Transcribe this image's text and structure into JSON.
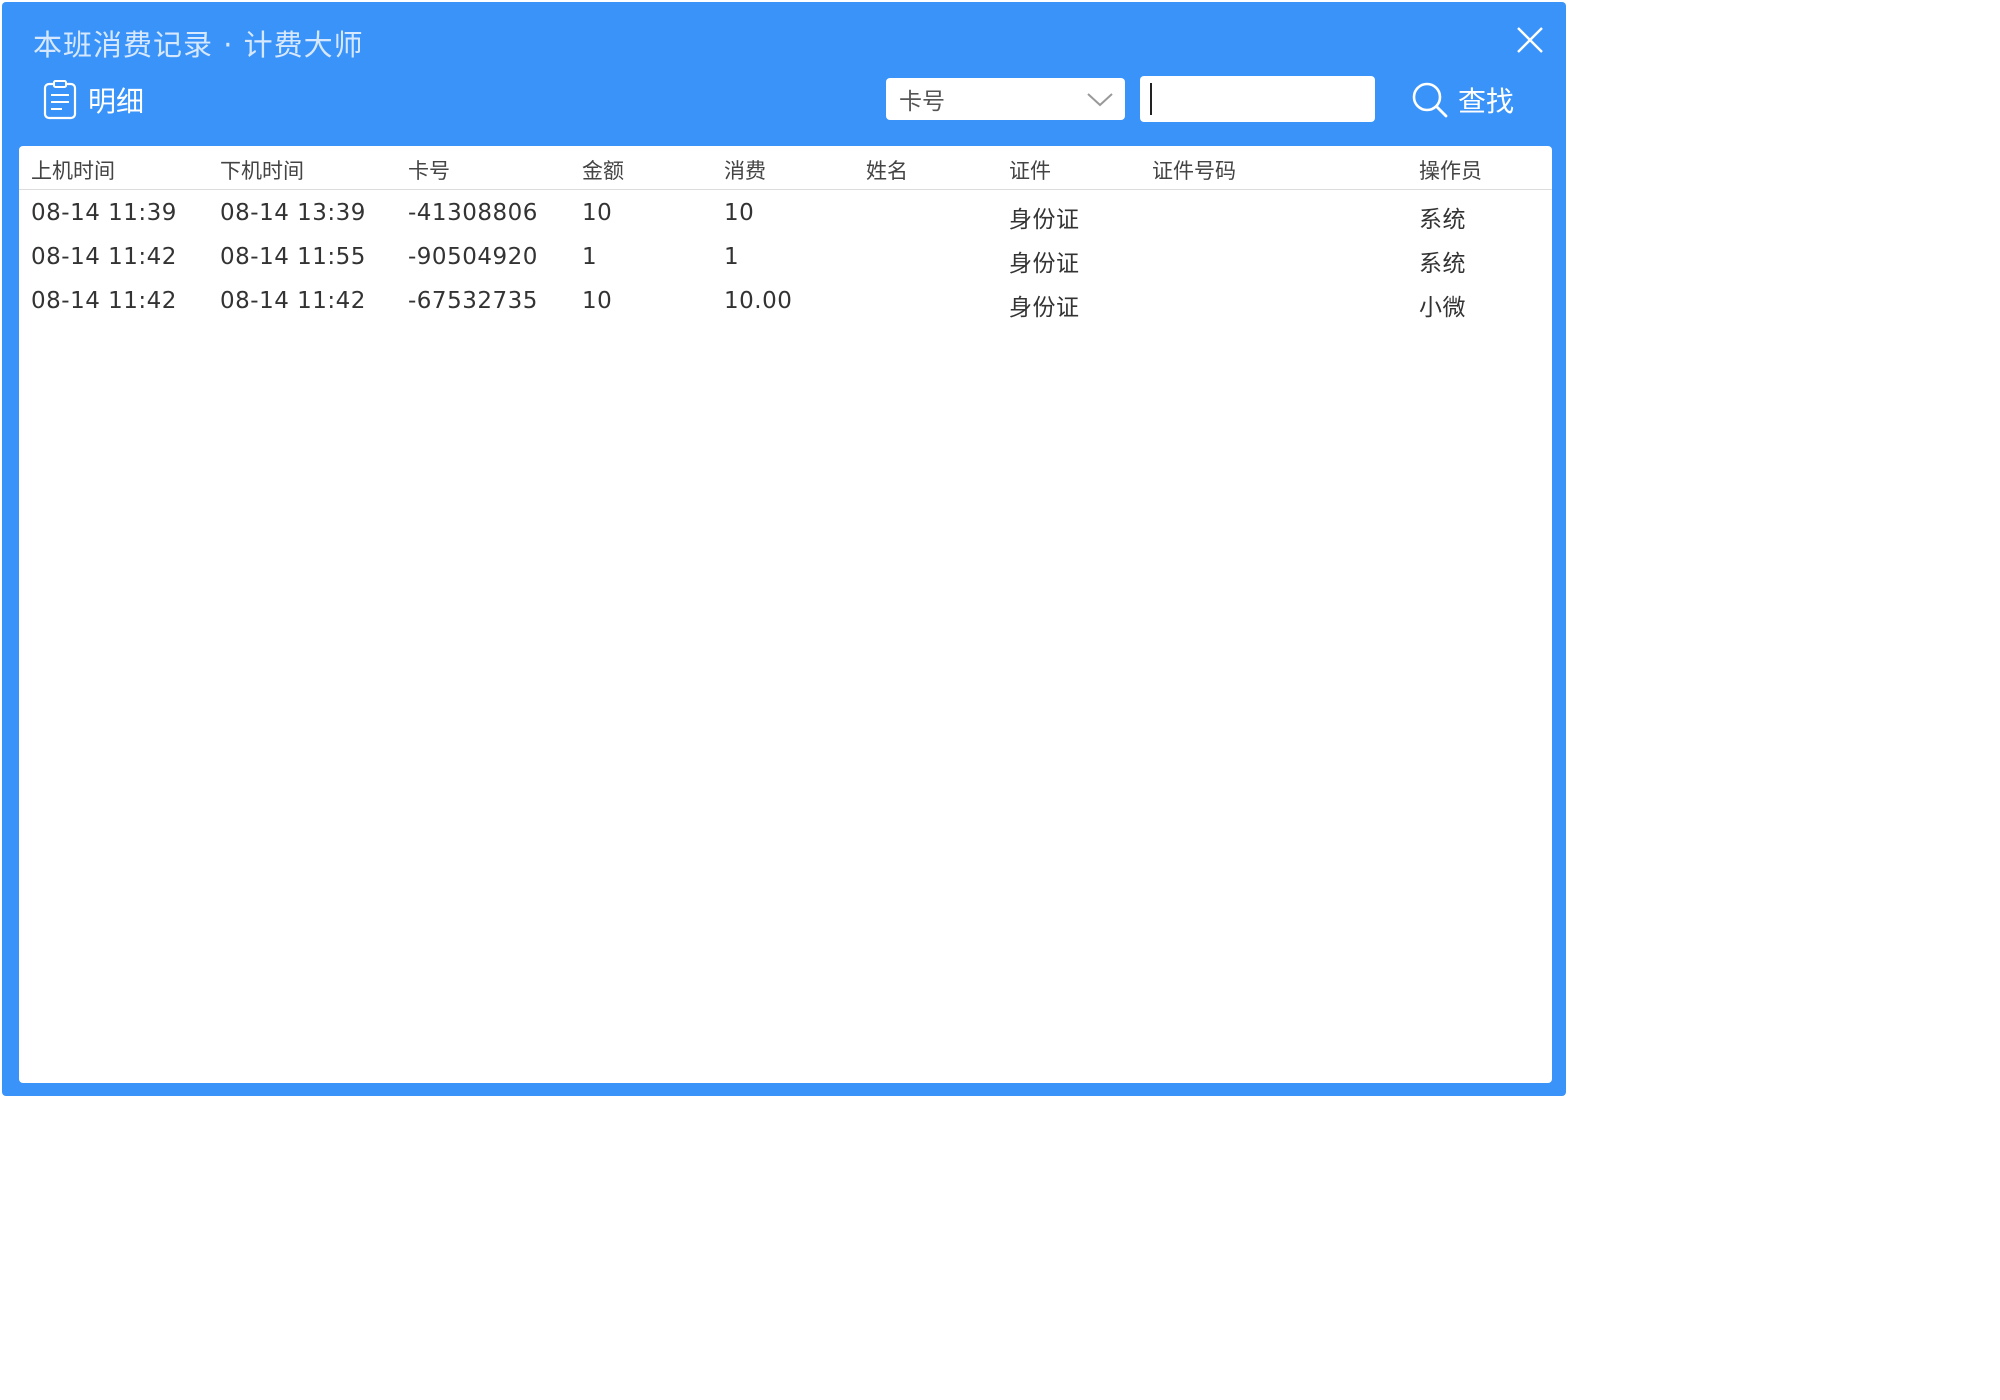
{
  "window": {
    "title": "本班消费记录 · 计费大师",
    "close_icon": "close-icon"
  },
  "toolbar": {
    "section_label": "明细",
    "section_icon": "clipboard-list-icon",
    "filter_field": {
      "selected": "卡号",
      "icon": "chevron-down-icon"
    },
    "search_input": {
      "value": "",
      "placeholder": ""
    },
    "search_button": {
      "label": "查找",
      "icon": "search-icon"
    }
  },
  "table": {
    "columns": [
      "上机时间",
      "下机时间",
      "卡号",
      "金额",
      "消费",
      "姓名",
      "证件",
      "证件号码",
      "操作员"
    ],
    "rows": [
      [
        "08-14 11:39",
        "08-14 13:39",
        "-41308806",
        "10",
        "10",
        "",
        "身份证",
        "",
        "系统"
      ],
      [
        "08-14 11:42",
        "08-14 11:55",
        "-90504920",
        "1",
        "1",
        "",
        "身份证",
        "",
        "系统"
      ],
      [
        "08-14 11:42",
        "08-14 11:42",
        "-67532735",
        "10",
        "10.00",
        "",
        "身份证",
        "",
        "小微"
      ]
    ]
  },
  "colors": {
    "window_bg": "#3a93f8",
    "title_text": "#d6e8ff",
    "panel_bg": "#ffffff",
    "cell_text": "#333333"
  }
}
